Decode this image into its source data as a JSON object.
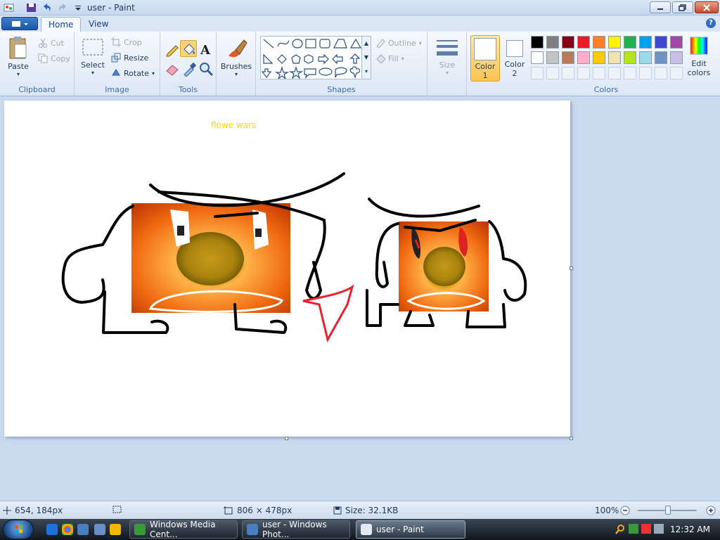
{
  "window": {
    "title": "user - Paint"
  },
  "tabs": [
    {
      "label": "Home"
    },
    {
      "label": "View"
    }
  ],
  "ribbon": {
    "clipboard": {
      "label": "Clipboard",
      "paste": "Paste",
      "cut": "Cut",
      "copy": "Copy"
    },
    "image": {
      "label": "Image",
      "select": "Select",
      "crop": "Crop",
      "resize": "Resize",
      "rotate": "Rotate"
    },
    "tools": {
      "label": "Tools"
    },
    "brushes": {
      "label": "Brushes"
    },
    "shapes": {
      "label": "Shapes",
      "outline": "Outline",
      "fill": "Fill"
    },
    "size": {
      "label": "Size"
    },
    "color1": {
      "line1": "Color",
      "line2": "1"
    },
    "color2": {
      "line1": "Color",
      "line2": "2"
    },
    "colors": {
      "label": "Colors",
      "edit_line1": "Edit",
      "edit_line2": "colors",
      "row1": [
        "#000000",
        "#7f7f7f",
        "#880015",
        "#ed1c24",
        "#ff7f27",
        "#fff200",
        "#22b14c",
        "#00a2e8",
        "#3f48cc",
        "#a349a4"
      ],
      "row2": [
        "#ffffff",
        "#c3c3c3",
        "#b97a57",
        "#ffaec9",
        "#ffc90e",
        "#efe4b0",
        "#b5e61d",
        "#99d9ea",
        "#7092be",
        "#c8bfe7"
      ]
    }
  },
  "canvas": {
    "text": "flowe wars"
  },
  "status": {
    "cursor": "654, 184px",
    "dimensions": "806 × 478px",
    "size": "Size: 32.1KB",
    "zoom": "100%"
  },
  "taskbar": {
    "items": [
      {
        "label": "Windows Media Cent..."
      },
      {
        "label": "user - Windows Phot..."
      },
      {
        "label": "user - Paint"
      }
    ],
    "clock": "12:32 AM"
  }
}
